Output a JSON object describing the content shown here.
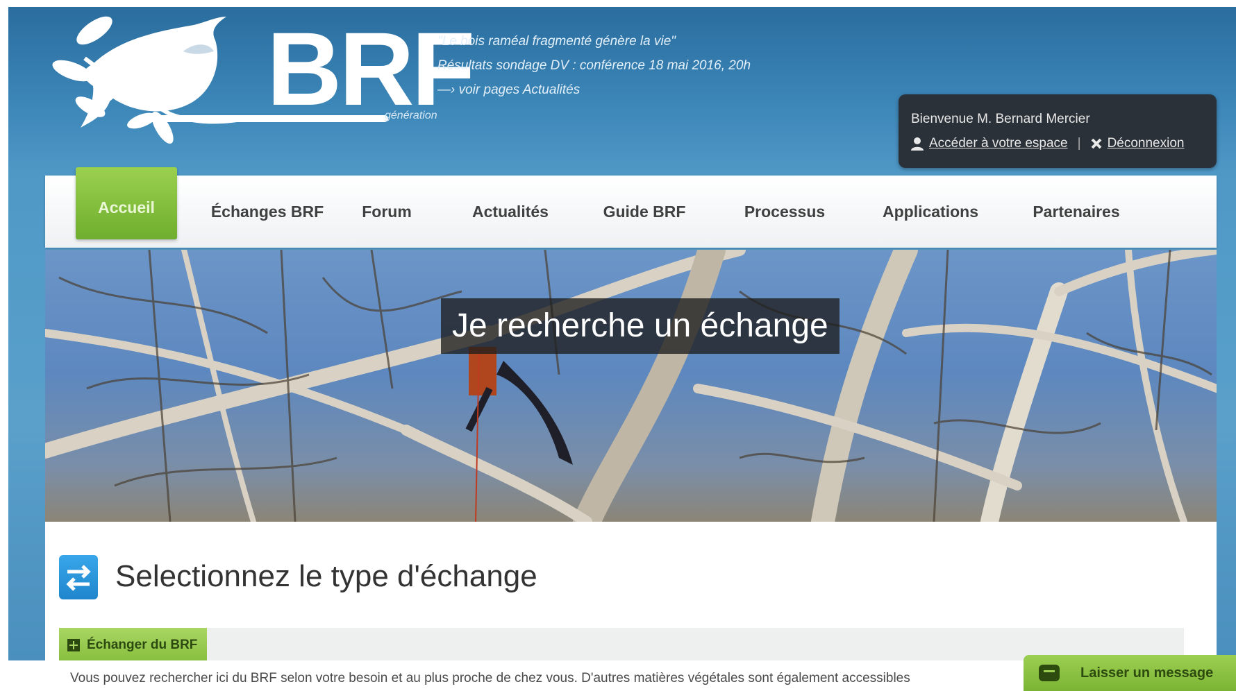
{
  "header": {
    "logo_text": "BRF",
    "logo_subtitle": "génération",
    "tagline": [
      "\"Le bois raméal fragmenté génère la vie\"",
      "Résultats sondage DV : conférence 18 mai 2016, 20h",
      "—› voir pages Actualités"
    ]
  },
  "user_box": {
    "welcome": "Bienvenue M. Bernard Mercier",
    "account_link": "Accéder à votre espace",
    "separator": "|",
    "logout_link": "Déconnexion"
  },
  "nav": {
    "items": [
      {
        "label": "Accueil",
        "active": true
      },
      {
        "label": "Échanges BRF",
        "active": false
      },
      {
        "label": "Forum",
        "active": false
      },
      {
        "label": "Actualités",
        "active": false
      },
      {
        "label": "Guide BRF",
        "active": false
      },
      {
        "label": "Processus",
        "active": false
      },
      {
        "label": "Applications",
        "active": false
      },
      {
        "label": "Partenaires",
        "active": false
      }
    ]
  },
  "hero": {
    "title": "Je recherche un échange"
  },
  "section": {
    "title": "Selectionnez le type d'échange",
    "tab_label": "Échanger du BRF",
    "description": "Vous pouvez rechercher ici du BRF selon votre besoin et au plus proche de chez vous. D'autres matières végétales sont également accessibles"
  },
  "chat": {
    "label": "Laisser un message"
  },
  "colors": {
    "header_blue": "#3c86b8",
    "nav_active_green": "#86be3d",
    "user_box_dark": "#2b3138",
    "section_icon_blue": "#2a95dc"
  }
}
